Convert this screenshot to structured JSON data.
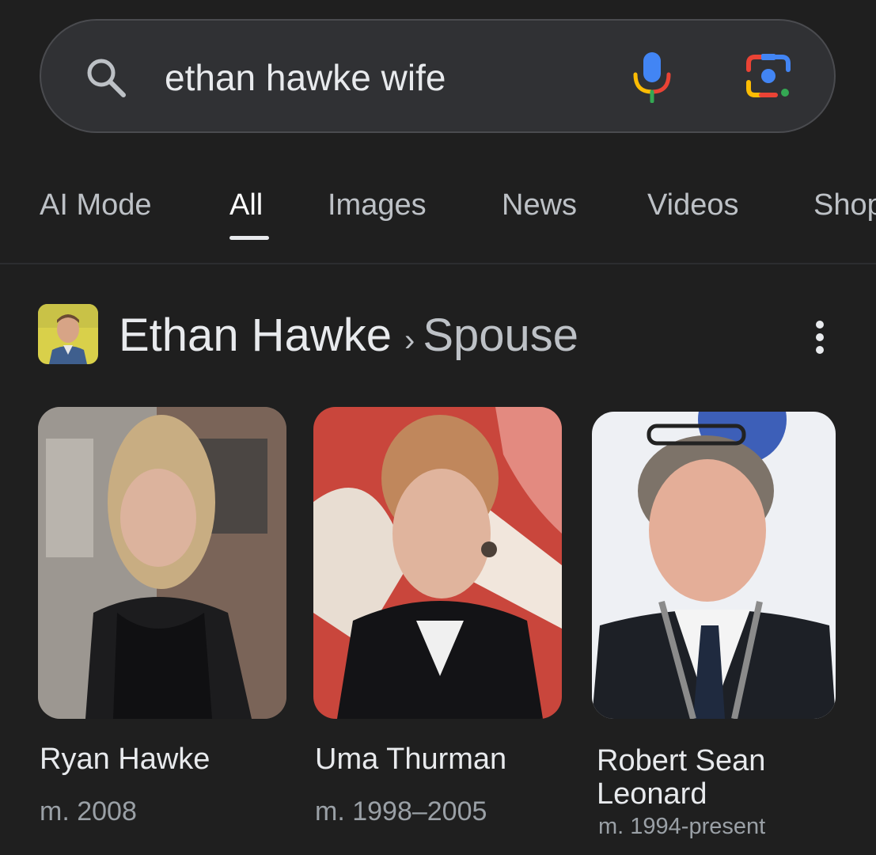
{
  "search": {
    "query": "ethan hawke wife",
    "icons": [
      "search-icon",
      "mic-icon",
      "google-lens-icon"
    ]
  },
  "tabs": [
    {
      "label": "AI Mode",
      "active": false
    },
    {
      "label": "All",
      "active": true
    },
    {
      "label": "Images",
      "active": false
    },
    {
      "label": "News",
      "active": false
    },
    {
      "label": "Videos",
      "active": false
    },
    {
      "label": "Shop",
      "active": false
    }
  ],
  "heading": {
    "entity": "Ethan Hawke",
    "separator": "›",
    "attribute": "Spouse",
    "menu_icon": "more-vert-icon"
  },
  "cards": [
    {
      "name": "Ryan Hawke",
      "meta": "m. 2008"
    },
    {
      "name": "Uma Thurman",
      "meta": "m. 1998–2005"
    },
    {
      "name": "Robert Sean Leonard",
      "meta": "m. 1994-present"
    }
  ],
  "colors": {
    "background": "#1f1f1f",
    "search_bar": "#303134",
    "google_blue": "#4285f4",
    "google_red": "#ea4335",
    "google_yellow": "#fbbc04",
    "google_green": "#34a853"
  }
}
